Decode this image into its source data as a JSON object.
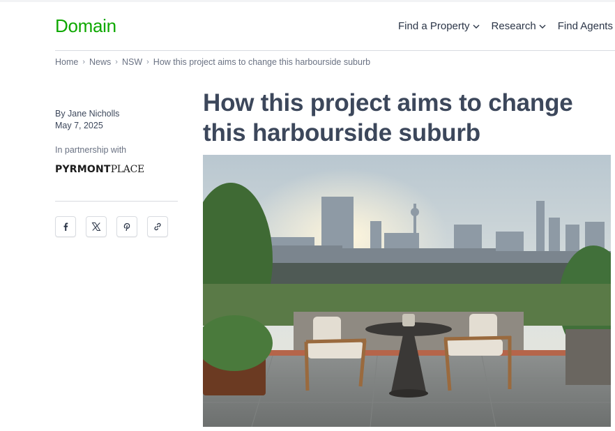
{
  "header": {
    "logo": "Domain",
    "nav": [
      {
        "label": "Find a Property",
        "has_menu": true
      },
      {
        "label": "Research",
        "has_menu": true
      },
      {
        "label": "Find Agents",
        "has_menu": false
      }
    ]
  },
  "breadcrumb": {
    "items": [
      "Home",
      "News",
      "NSW",
      "How this project aims to change this harbourside suburb"
    ],
    "separator": "›"
  },
  "article": {
    "byline": "By Jane Nicholls",
    "date": "May 7, 2025",
    "partner_label": "In partnership with",
    "partner_logo": {
      "bold": "PYRMONT",
      "light": "PLACE"
    },
    "title": "How this project aims to change this harbourside suburb",
    "share": [
      "facebook-icon",
      "x-icon",
      "pinterest-icon",
      "link-icon"
    ]
  },
  "colors": {
    "brand": "#0ea800",
    "title": "#3c475b",
    "muted": "#6a7283"
  }
}
